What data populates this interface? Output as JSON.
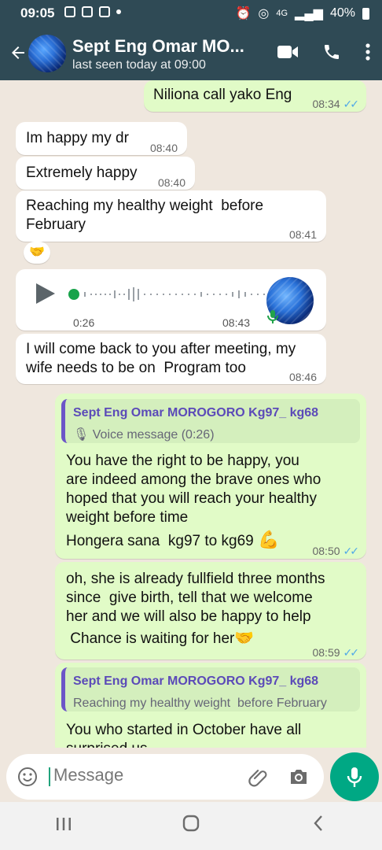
{
  "status_bar": {
    "time": "09:05",
    "battery": "40%",
    "network": "4G"
  },
  "header": {
    "name": "Sept Eng Omar MO...",
    "status": "last seen today at 09:00"
  },
  "messages": {
    "m1": {
      "text": "Niliona call yako Eng",
      "time": "08:34"
    },
    "m2": {
      "text": "Im happy my dr",
      "time": "08:40"
    },
    "m3": {
      "text": "Extremely happy",
      "time": "08:40"
    },
    "m4": {
      "text_line1": "Reaching my healthy weight  before",
      "text_line2": "February",
      "time": "08:41",
      "reaction": "🤝"
    },
    "m5": {
      "duration": "0:26",
      "time": "08:43"
    },
    "m6": {
      "text_line1": "I will come back to you after meeting, my",
      "text_line2": "wife needs to be on  Program too",
      "time": "08:46"
    },
    "m7": {
      "quote_name": "Sept Eng Omar MOROGORO Kg97_ kg68",
      "quote_text": "Voice message (0:26)",
      "lines": [
        "You have the right to be happy, you",
        "are indeed among the brave ones who",
        "hoped that you will reach your healthy",
        "weight before time"
      ],
      "line_last": "Hongera sana  kg97 to kg69",
      "emoji": "💪",
      "time": "08:50"
    },
    "m8": {
      "lines": [
        "oh, she is  already fullfield three months",
        "since  give birth, tell that we welcome",
        "her and we will also be happy to help"
      ],
      "line_last": " Chance is waiting for her",
      "emoji": "🤝",
      "time": "08:59"
    },
    "m9": {
      "quote_name": "Sept Eng Omar MOROGORO Kg97_ kg68",
      "quote_text": "Reaching my healthy weight  before February",
      "line1": "You who started in October have all",
      "line2": "surprised us"
    }
  },
  "composer": {
    "placeholder": "Message"
  },
  "colors": {
    "header": "#2f4a55",
    "accent": "#00a884",
    "outgoing": "#e1fbc7",
    "incoming": "#ffffff"
  },
  "icons": [
    "back-arrow-icon",
    "video-call-icon",
    "phone-icon",
    "more-options-icon",
    "emoji-icon",
    "attach-icon",
    "camera-icon",
    "mic-icon",
    "play-icon"
  ]
}
